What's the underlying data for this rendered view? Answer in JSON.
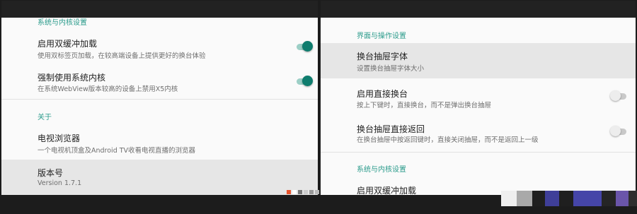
{
  "left_screen": {
    "partial_section": "系统与内核设置",
    "items": [
      {
        "title": "启用双缓冲加载",
        "subtitle": "使用双标签页加载，在较高端设备上提供更好的换台体验",
        "switch": "on"
      },
      {
        "title": "强制使用系统内核",
        "subtitle": "在系统WebView版本较高的设备上禁用X5内核",
        "switch": "on"
      }
    ],
    "about_section": "关于",
    "about_items": [
      {
        "title": "电视浏览器",
        "subtitle": "一个电视机顶盒及Android TV收看电视直播的浏览器"
      },
      {
        "title": "版本号",
        "subtitle": "Version 1.7.1"
      }
    ]
  },
  "right_screen": {
    "section": "界面与操作设置",
    "items": [
      {
        "title": "换台抽屉字体",
        "subtitle": "设置换台抽屉字体大小"
      },
      {
        "title": "启用直接换台",
        "subtitle": "按上下键时，直接换台，而不是弹出换台抽屉",
        "switch": "off"
      },
      {
        "title": "换台抽屉直接返回",
        "subtitle": "在换台抽屉中按返回键时，直接关闭抽屉，而不是返回上一级",
        "switch": "off"
      }
    ],
    "section2": "系统与内核设置",
    "partial_item": "启用双缓冲加载"
  },
  "colors": {
    "accent": "#2a9b8b",
    "switch_on": "#0f7d6e",
    "selected_bg": "#e6e6e6"
  }
}
